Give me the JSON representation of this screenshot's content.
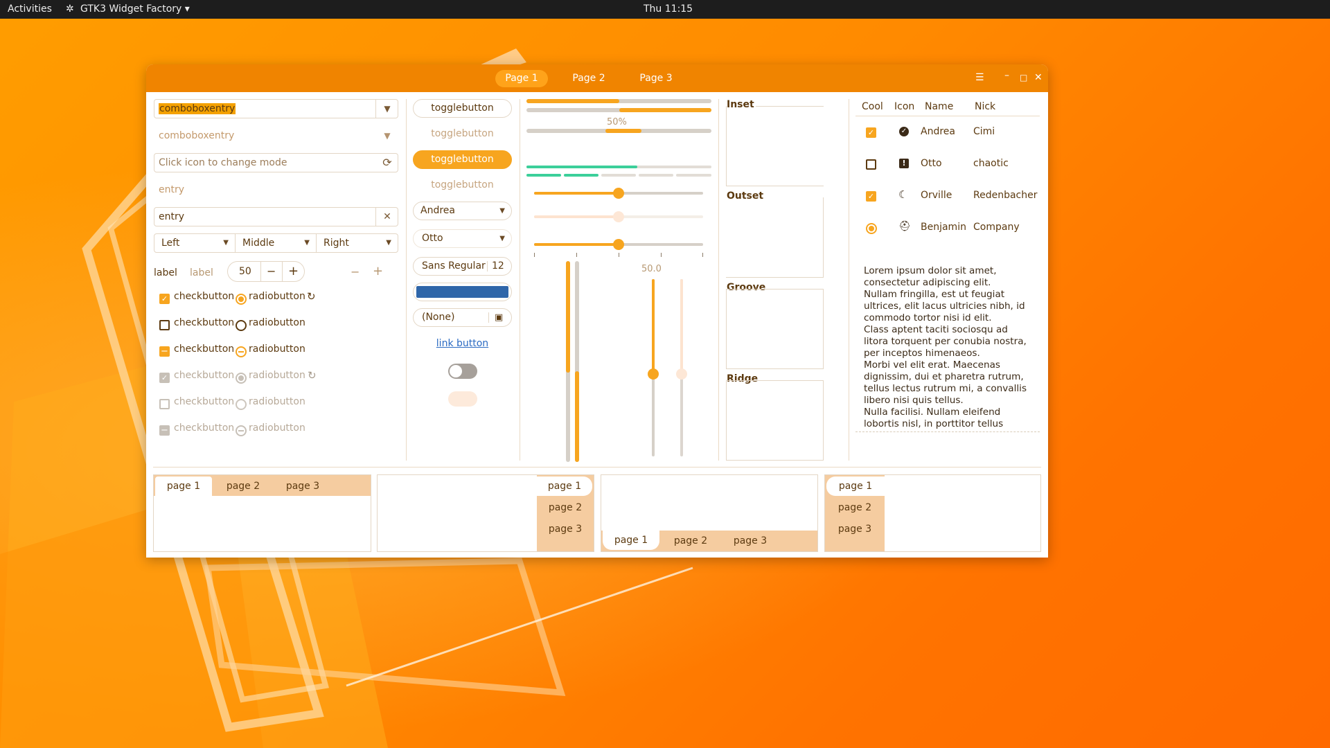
{
  "topbar": {
    "activities": "Activities",
    "app_name": "GTK3 Widget Factory",
    "clock": "Thu 11:15"
  },
  "window": {
    "tabs": [
      "Page 1",
      "Page 2",
      "Page 3"
    ],
    "active_tab": "Page 1",
    "controls": {
      "menu": "☰",
      "minimize": "–",
      "maximize": "□",
      "close": "✕"
    }
  },
  "col1": {
    "combo_entry_1": "comboboxentry",
    "combo_entry_2": "comboboxentry",
    "icon_entry_placeholder": "Click icon to change mode",
    "entry_flat": "entry",
    "entry_clear": "entry",
    "combos": [
      "Left",
      "Middle",
      "Right"
    ],
    "label_1": "label",
    "label_2": "label",
    "spin_value": "50",
    "checks": [
      "checkbutton",
      "checkbutton",
      "checkbutton",
      "checkbutton",
      "checkbutton",
      "checkbutton"
    ],
    "radios": [
      "radiobutton",
      "radiobutton",
      "radiobutton",
      "radiobutton",
      "radiobutton",
      "radiobutton"
    ]
  },
  "col2": {
    "toggles": [
      "togglebutton",
      "togglebutton",
      "togglebutton",
      "togglebutton"
    ],
    "combo_andrea": "Andrea",
    "combo_otto": "Otto",
    "font_name": "Sans Regular",
    "font_size": "12",
    "color_hex": "#2f66a9",
    "file_chooser": "(None)",
    "link": "link button",
    "switch_on": false
  },
  "col3": {
    "progress_label": "50%",
    "progress_fraction": 0.5,
    "hscale_1": 0.5,
    "hscale_3": 0.5,
    "vscale_value": "50.0",
    "vscale_fraction": 0.5
  },
  "frames": [
    "Inset",
    "Outset",
    "Groove",
    "Ridge"
  ],
  "tree": {
    "headers": [
      "Cool",
      "Icon",
      "Name",
      "Nick"
    ],
    "rows": [
      {
        "cool": "checked",
        "icon": "checkmark-circle-icon",
        "name": "Andrea",
        "nick": "Cimi"
      },
      {
        "cool": "unchecked",
        "icon": "warning-icon",
        "name": "Otto",
        "nick": "chaotic"
      },
      {
        "cool": "checked",
        "icon": "moon-icon",
        "name": "Orville",
        "nick": "Redenbacher"
      },
      {
        "cool": "radio",
        "icon": "hat-icon",
        "name": "Benjamin",
        "nick": "Company"
      }
    ]
  },
  "textview": "Lorem ipsum dolor sit amet,\nconsectetur adipiscing elit.\nNullam fringilla, est ut feugiat\nultrices, elit lacus ultricies nibh, id\ncommodo tortor nisi id elit.\nClass aptent taciti sociosqu ad\nlitora torquent per conubia nostra,\nper inceptos himenaeos.\nMorbi vel elit erat. Maecenas\ndignissim, dui et pharetra rutrum,\ntellus lectus rutrum mi, a convallis\nlibero nisi quis tellus.\nNulla facilisi. Nullam eleifend\nlobortis nisl, in porttitor tellus",
  "notebooks": {
    "tabs": [
      "page 1",
      "page 2",
      "page 3"
    ]
  },
  "colors": {
    "accent": "#f7a51f",
    "header": "#f08400",
    "tab_strip": "#f5cca0",
    "teal": "#3ccf9a"
  }
}
